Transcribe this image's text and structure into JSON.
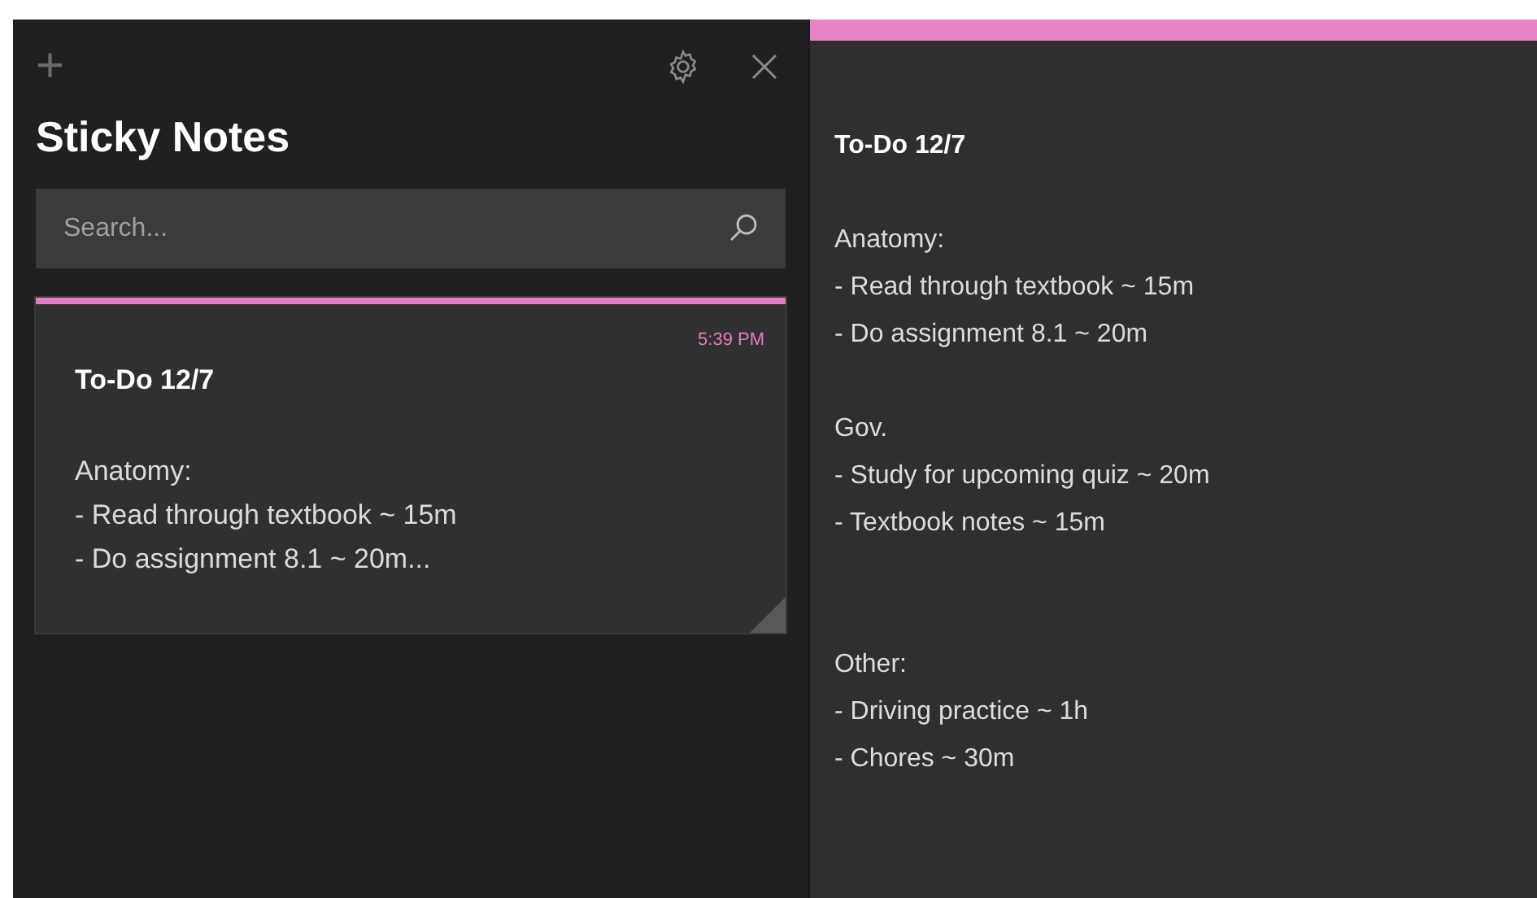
{
  "sidebar": {
    "toolbar": {
      "add_icon": "+"
    },
    "title": "Sticky Notes",
    "search": {
      "placeholder": "Search..."
    },
    "notes": [
      {
        "color": "#e07fc0",
        "time": "5:39 PM",
        "title": "To-Do 12/7",
        "selected": true,
        "preview": [
          "Anatomy:",
          "- Read through textbook ~ 15m",
          "- Do assignment 8.1 ~ 20m..."
        ]
      }
    ]
  },
  "editor": {
    "color": "#e884c4",
    "lines": [
      {
        "kind": "title",
        "text": "To-Do 12/7"
      },
      {
        "kind": "blank"
      },
      {
        "kind": "text",
        "text": "Anatomy:"
      },
      {
        "kind": "text",
        "text": "- Read through textbook ~ 15m"
      },
      {
        "kind": "text",
        "text": "- Do assignment 8.1 ~ 20m"
      },
      {
        "kind": "blank"
      },
      {
        "kind": "text",
        "text": "Gov."
      },
      {
        "kind": "text",
        "text": "- Study for upcoming quiz ~ 20m"
      },
      {
        "kind": "text",
        "text": "- Textbook notes ~ 15m"
      },
      {
        "kind": "blank"
      },
      {
        "kind": "blank"
      },
      {
        "kind": "text",
        "text": "Other:"
      },
      {
        "kind": "text",
        "text": "- Driving practice ~ 1h"
      },
      {
        "kind": "text",
        "text": "- Chores ~ 30m"
      }
    ]
  }
}
